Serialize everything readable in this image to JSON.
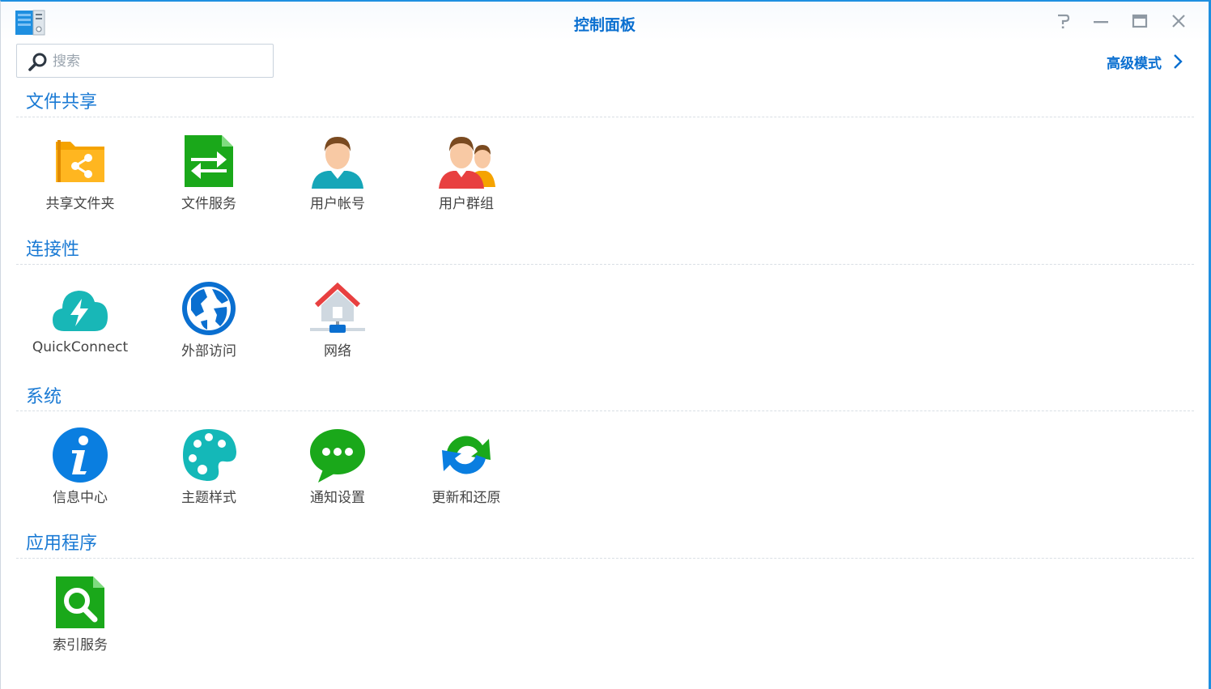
{
  "window": {
    "title": "控制面板"
  },
  "search": {
    "placeholder": "搜索",
    "value": ""
  },
  "advanced_mode": "高级模式",
  "sections": [
    {
      "title": "文件共享",
      "items": [
        "共享文件夹",
        "文件服务",
        "用户帐号",
        "用户群组"
      ]
    },
    {
      "title": "连接性",
      "items": [
        "QuickConnect",
        "外部访问",
        "网络"
      ]
    },
    {
      "title": "系统",
      "items": [
        "信息中心",
        "主题样式",
        "通知设置",
        "更新和还原"
      ]
    },
    {
      "title": "应用程序",
      "items": [
        "索引服务"
      ]
    }
  ],
  "colors": {
    "accent": "#0a6fd0",
    "section": "#1a7ad4",
    "border": "#1e8fe0"
  }
}
